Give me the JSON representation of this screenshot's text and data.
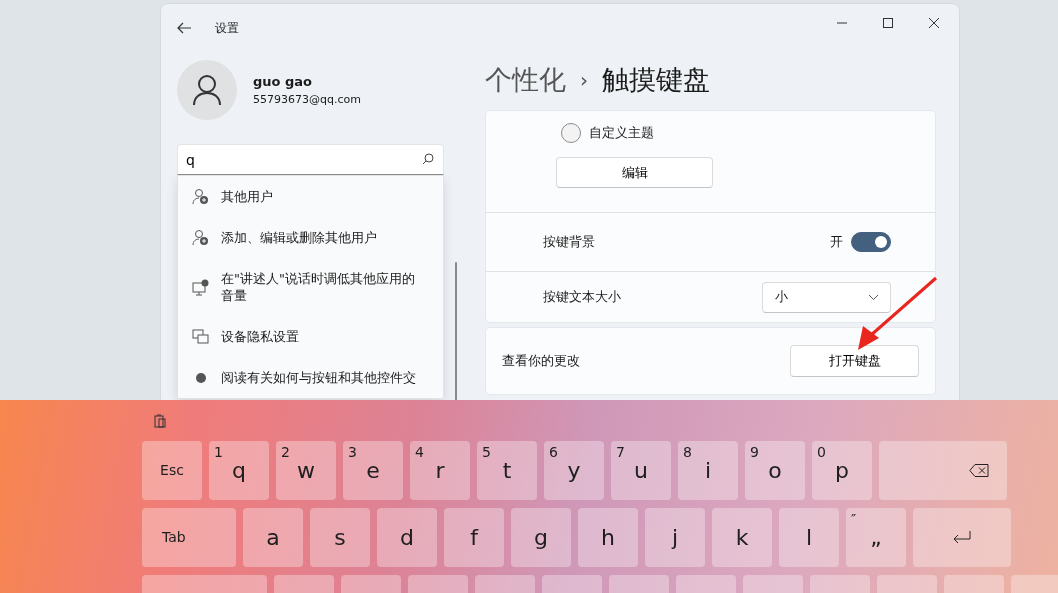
{
  "window": {
    "title": "设置"
  },
  "user": {
    "name": "guo gao",
    "email": "55793673@qq.com"
  },
  "search": {
    "value": "q"
  },
  "search_results": [
    {
      "label": "其他用户",
      "kind": "user-add"
    },
    {
      "label": "添加、编辑或删除其他用户",
      "kind": "user-add"
    },
    {
      "label": "在\"讲述人\"说话时调低其他应用的音量",
      "kind": "monitor"
    },
    {
      "label": "设备隐私设置",
      "kind": "devices"
    },
    {
      "label": "阅读有关如何与按钮和其他控件交",
      "kind": "info"
    }
  ],
  "breadcrumb": {
    "parent": "个性化",
    "separator": "›",
    "current": "触摸键盘"
  },
  "theme_option": {
    "label": "自定义主题",
    "selected": false
  },
  "edit_button": "编辑",
  "key_background": {
    "label": "按键背景",
    "state_text": "开",
    "on": true
  },
  "key_text_size": {
    "label": "按键文本大小",
    "value": "小"
  },
  "preview": {
    "label": "查看你的更改",
    "button": "打开键盘"
  },
  "keyboard": {
    "rows": [
      [
        {
          "kind": "text",
          "label": "Esc"
        },
        {
          "kind": "letter",
          "label": "q",
          "hint": "1"
        },
        {
          "kind": "letter",
          "label": "w",
          "hint": "2"
        },
        {
          "kind": "letter",
          "label": "e",
          "hint": "3"
        },
        {
          "kind": "letter",
          "label": "r",
          "hint": "4"
        },
        {
          "kind": "letter",
          "label": "t",
          "hint": "5"
        },
        {
          "kind": "letter",
          "label": "y",
          "hint": "6"
        },
        {
          "kind": "letter",
          "label": "u",
          "hint": "7"
        },
        {
          "kind": "letter",
          "label": "i",
          "hint": "8"
        },
        {
          "kind": "letter",
          "label": "o",
          "hint": "9"
        },
        {
          "kind": "letter",
          "label": "p",
          "hint": "0"
        },
        {
          "kind": "backspace"
        }
      ],
      [
        {
          "kind": "tab",
          "label": "Tab"
        },
        {
          "kind": "letter",
          "label": "a"
        },
        {
          "kind": "letter",
          "label": "s"
        },
        {
          "kind": "letter",
          "label": "d"
        },
        {
          "kind": "letter",
          "label": "f"
        },
        {
          "kind": "letter",
          "label": "g"
        },
        {
          "kind": "letter",
          "label": "h"
        },
        {
          "kind": "letter",
          "label": "j"
        },
        {
          "kind": "letter",
          "label": "k"
        },
        {
          "kind": "letter",
          "label": "l"
        },
        {
          "kind": "letter",
          "label": "„",
          "hint": "″"
        },
        {
          "kind": "enter"
        }
      ],
      [
        {
          "kind": "wide"
        },
        {
          "kind": "blank"
        },
        {
          "kind": "blank"
        },
        {
          "kind": "blank"
        },
        {
          "kind": "blank"
        },
        {
          "kind": "blank"
        },
        {
          "kind": "blank"
        },
        {
          "kind": "blank"
        },
        {
          "kind": "blank"
        },
        {
          "kind": "blank"
        },
        {
          "kind": "blank"
        },
        {
          "kind": "blank"
        },
        {
          "kind": "blank"
        }
      ]
    ]
  }
}
